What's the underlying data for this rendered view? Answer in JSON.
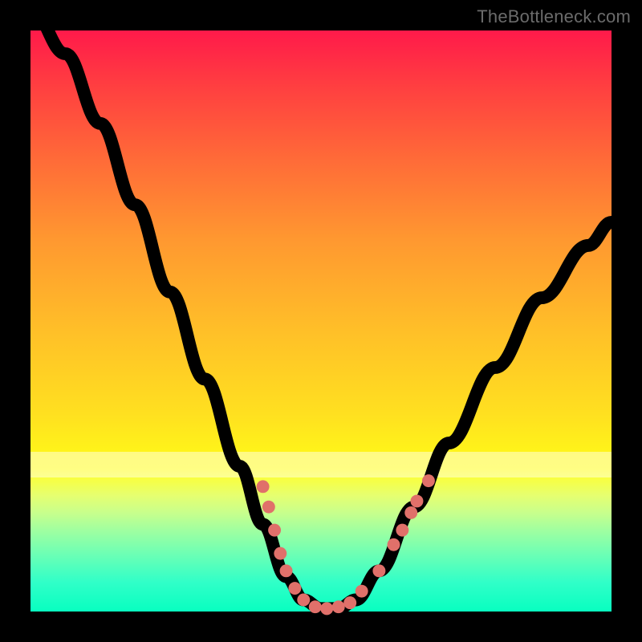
{
  "watermark": "TheBottleneck.com",
  "colors": {
    "frame": "#000000",
    "curve": "#000000",
    "marker": "#e0706a",
    "gradient_top": "#ff1a4a",
    "gradient_bottom": "#08ffc0"
  },
  "chart_data": {
    "type": "line",
    "title": "",
    "xlabel": "",
    "ylabel": "",
    "xlim": [
      0,
      100
    ],
    "ylim": [
      0,
      100
    ],
    "curve": [
      {
        "x": 0,
        "y": 104
      },
      {
        "x": 6,
        "y": 96
      },
      {
        "x": 12,
        "y": 84
      },
      {
        "x": 18,
        "y": 70
      },
      {
        "x": 24,
        "y": 55
      },
      {
        "x": 30,
        "y": 40
      },
      {
        "x": 36,
        "y": 25
      },
      {
        "x": 40,
        "y": 15
      },
      {
        "x": 44,
        "y": 6
      },
      {
        "x": 47,
        "y": 2
      },
      {
        "x": 50,
        "y": 0.5
      },
      {
        "x": 53,
        "y": 0.5
      },
      {
        "x": 56,
        "y": 2
      },
      {
        "x": 60,
        "y": 7
      },
      {
        "x": 66,
        "y": 18
      },
      {
        "x": 72,
        "y": 29
      },
      {
        "x": 80,
        "y": 42
      },
      {
        "x": 88,
        "y": 54
      },
      {
        "x": 96,
        "y": 63
      },
      {
        "x": 100,
        "y": 67
      }
    ],
    "markers": [
      {
        "x": 40,
        "y": 21.5
      },
      {
        "x": 41,
        "y": 18
      },
      {
        "x": 42,
        "y": 14
      },
      {
        "x": 43,
        "y": 10
      },
      {
        "x": 44,
        "y": 7
      },
      {
        "x": 45.5,
        "y": 4
      },
      {
        "x": 47,
        "y": 2
      },
      {
        "x": 49,
        "y": 0.8
      },
      {
        "x": 51,
        "y": 0.5
      },
      {
        "x": 53,
        "y": 0.8
      },
      {
        "x": 55,
        "y": 1.5
      },
      {
        "x": 57,
        "y": 3.5
      },
      {
        "x": 60,
        "y": 7
      },
      {
        "x": 62.5,
        "y": 11.5
      },
      {
        "x": 64,
        "y": 14
      },
      {
        "x": 65.5,
        "y": 17
      },
      {
        "x": 66.5,
        "y": 19
      },
      {
        "x": 68.5,
        "y": 22.5
      }
    ]
  }
}
